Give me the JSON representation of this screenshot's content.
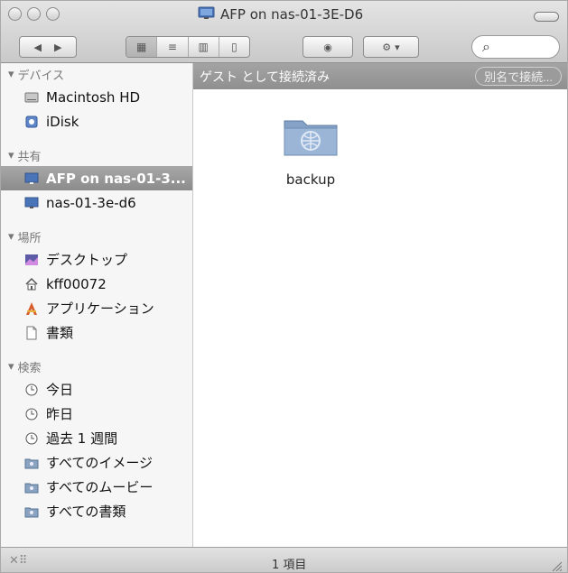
{
  "window": {
    "title": "AFP on nas-01-3E-D6"
  },
  "header": {
    "connection_status": "ゲスト として接続済み",
    "rename_button": "別名で接続..."
  },
  "sidebar": {
    "devices_title": "デバイス",
    "devices": [
      {
        "label": "Macintosh HD",
        "icon": "hard-drive-icon"
      },
      {
        "label": "iDisk",
        "icon": "idisk-icon"
      }
    ],
    "shared_title": "共有",
    "shared": [
      {
        "label": "AFP on nas-01-3...",
        "icon": "display-icon",
        "selected": true
      },
      {
        "label": "nas-01-3e-d6",
        "icon": "display-icon"
      }
    ],
    "places_title": "場所",
    "places": [
      {
        "label": "デスクトップ",
        "icon": "desktop-icon"
      },
      {
        "label": "kff00072",
        "icon": "home-icon"
      },
      {
        "label": "アプリケーション",
        "icon": "applications-icon"
      },
      {
        "label": "書類",
        "icon": "document-icon"
      }
    ],
    "search_title": "検索",
    "search_items": [
      {
        "label": "今日",
        "icon": "clock-icon"
      },
      {
        "label": "昨日",
        "icon": "clock-icon"
      },
      {
        "label": "過去 1 週間",
        "icon": "clock-icon"
      },
      {
        "label": "すべてのイメージ",
        "icon": "smart-folder-icon"
      },
      {
        "label": "すべてのムービー",
        "icon": "smart-folder-icon"
      },
      {
        "label": "すべての書類",
        "icon": "smart-folder-icon"
      }
    ]
  },
  "content": {
    "items": [
      {
        "label": "backup",
        "icon": "network-folder-icon"
      }
    ]
  },
  "status_bar": {
    "text": "1 項目"
  },
  "colors": {
    "selection": "#959595",
    "folder": "#7f9bbd",
    "header_bar": "#9b9b9b"
  }
}
